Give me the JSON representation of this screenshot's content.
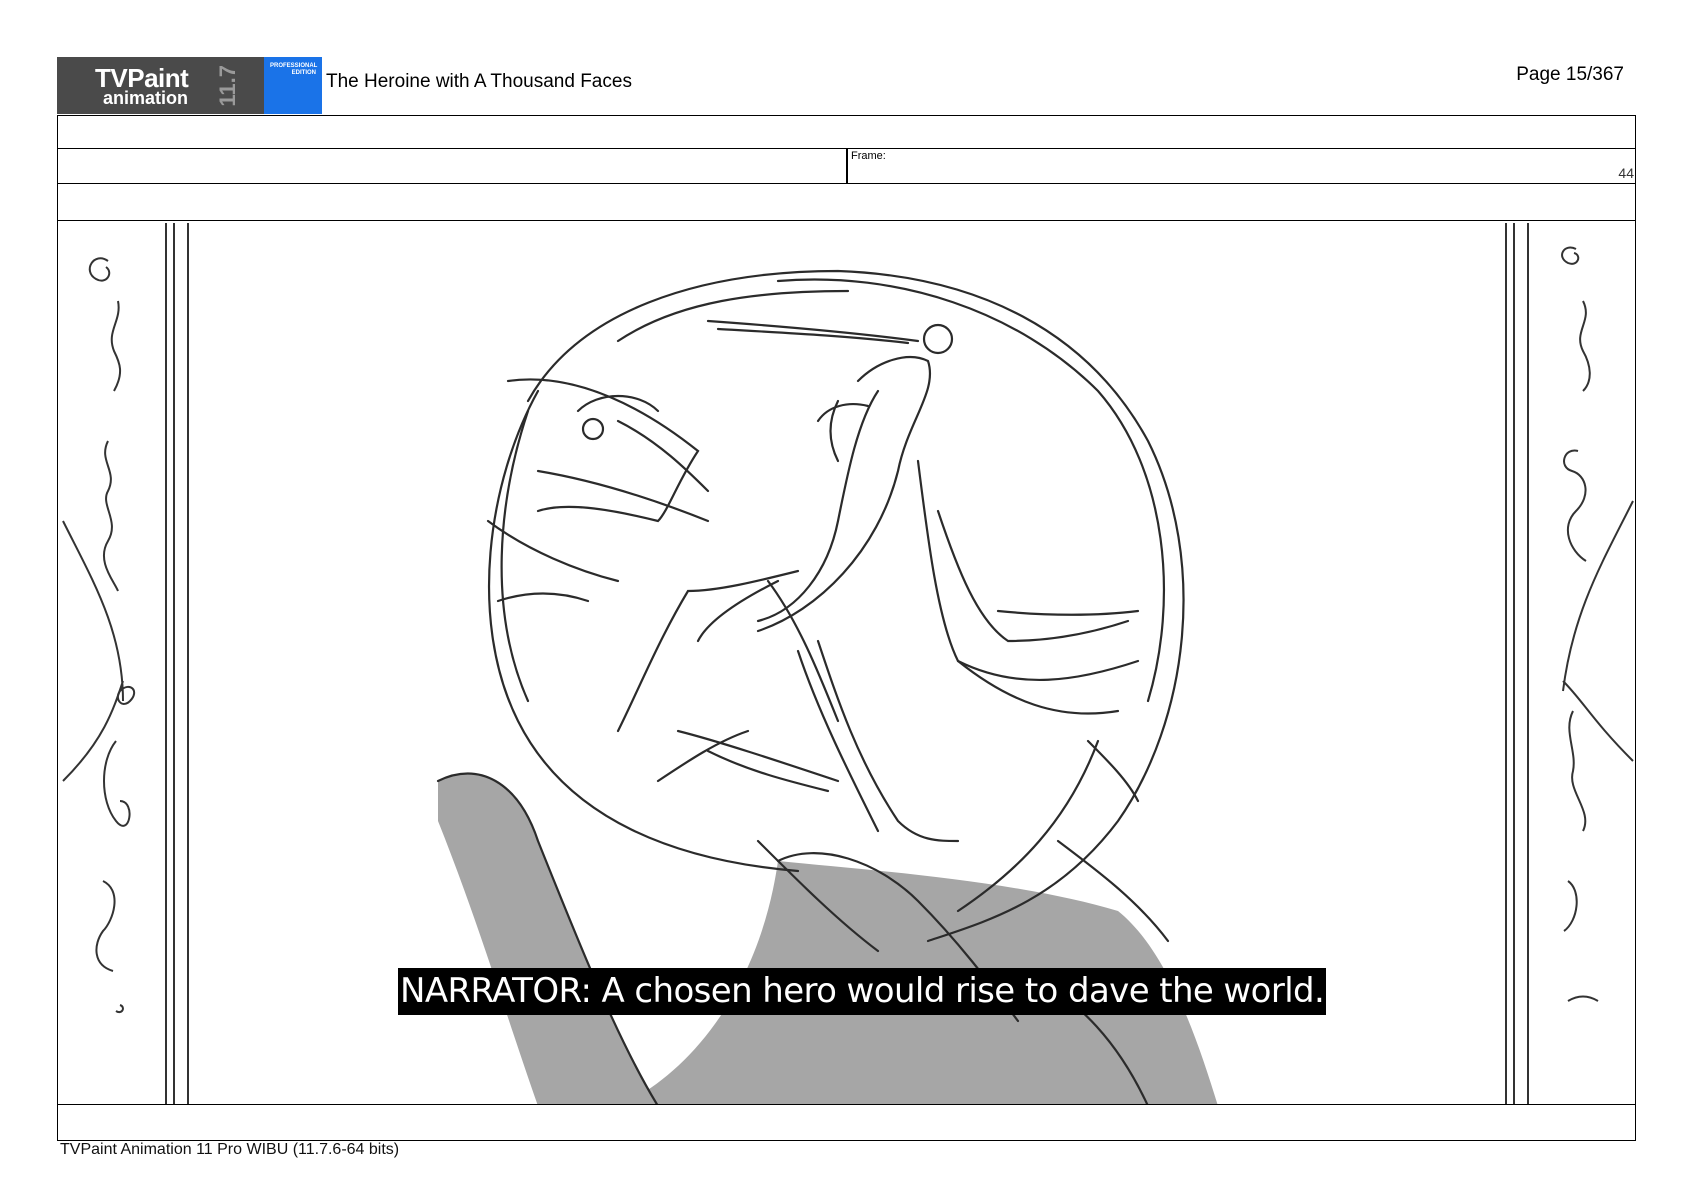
{
  "header": {
    "logo": {
      "brand": "TVPaint",
      "sub": "animation",
      "version": "11.7",
      "edition": "PROFESSIONAL EDITION"
    },
    "title": "The Heroine with A Thousand Faces",
    "page": "Page 15/367"
  },
  "frame": {
    "label": "Frame:",
    "value": "44"
  },
  "panel": {
    "caption": "NARRATOR: A chosen hero would rise to dave the world."
  },
  "footer": {
    "text": "TVPaint Animation 11 Pro WIBU (11.7.6-64 bits)"
  },
  "colors": {
    "logo_dark": "#4a4a4a",
    "logo_blue": "#1a73e8",
    "tone_fill": "#a6a6a6"
  }
}
